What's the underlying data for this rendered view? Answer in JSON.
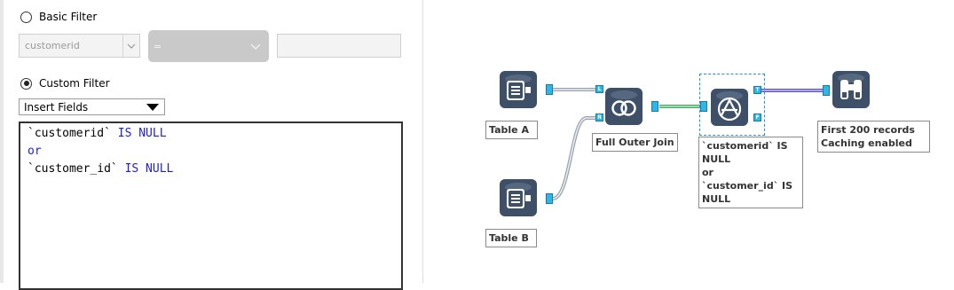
{
  "filter_panel": {
    "basic_filter": {
      "label": "Basic Filter",
      "selected": false
    },
    "field_select": {
      "value": "customerid"
    },
    "operator_select": {
      "value": "="
    },
    "value_input": {
      "value": ""
    },
    "custom_filter": {
      "label": "Custom Filter",
      "selected": true
    },
    "insert_fields": {
      "label": "Insert Fields"
    },
    "expression": [
      [
        {
          "text": "`customerid`",
          "style": "ident"
        },
        {
          "text": " IS NULL",
          "style": "kw"
        }
      ],
      [
        {
          "text": "or",
          "style": "kw"
        }
      ],
      [
        {
          "text": "`customer_id`",
          "style": "ident"
        },
        {
          "text": " IS NULL",
          "style": "kw"
        }
      ]
    ]
  },
  "workflow": {
    "tools": {
      "table_a": {
        "icon": "input-data-icon",
        "label": "Table A"
      },
      "table_b": {
        "icon": "input-data-icon",
        "label": "Table B"
      },
      "join": {
        "icon": "join-icon",
        "label": "Full Outer Join",
        "ports": [
          "L",
          "R"
        ]
      },
      "filter": {
        "icon": "filter-icon",
        "label_lines": [
          "`customerid` IS",
          "NULL",
          "or",
          "`customer_id` IS",
          "NULL"
        ],
        "ports": [
          "T",
          "F"
        ]
      },
      "browse": {
        "icon": "browse-icon",
        "label_lines": [
          "First 200 records",
          "Caching enabled"
        ]
      }
    }
  },
  "colors": {
    "tool_fill": "#3e5068",
    "anchor": "#30b6e6",
    "keyword": "#1f1fd6",
    "selection": "#2a8fd6"
  }
}
